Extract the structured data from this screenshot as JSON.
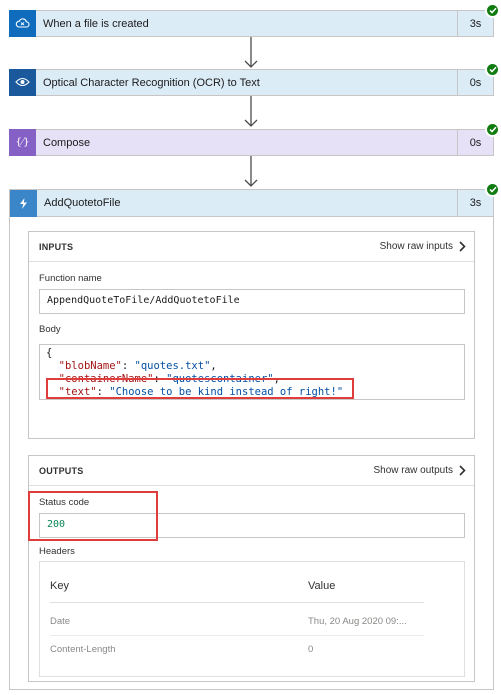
{
  "steps": [
    {
      "title": "When a file is created",
      "duration": "3s",
      "icon": "cloud-icon",
      "color": "#0f6cbd",
      "bg": "#dcecf7"
    },
    {
      "title": "Optical Character Recognition (OCR) to Text",
      "duration": "0s",
      "icon": "eye-icon",
      "color": "#1a5a9c",
      "bg": "#dcecf7"
    },
    {
      "title": "Compose",
      "duration": "0s",
      "icon": "braces-icon",
      "color": "#8661c5",
      "bg": "#e7e1f7"
    }
  ],
  "action": {
    "title": "AddQuotetoFile",
    "duration": "3s",
    "icon": "function-icon",
    "color": "#3b85c9"
  },
  "inputs": {
    "label": "INPUTS",
    "raw_link": "Show raw inputs",
    "function_name_label": "Function name",
    "function_name_value": "AppendQuoteToFile/AddQuotetoFile",
    "body_label": "Body",
    "body_lines": {
      "open": "{",
      "blobName_key": "\"blobName\"",
      "blobName_value": "\"quotes.txt\"",
      "containerName_key": "\"containerName\"",
      "containerName_value": "\"quotescontainer\"",
      "text_key": "\"text\"",
      "text_value": "\"Choose to be kind instead of right!\"",
      "close": "}"
    }
  },
  "outputs": {
    "label": "OUTPUTS",
    "raw_link": "Show raw outputs",
    "status_label": "Status code",
    "status_value": "200",
    "headers_label": "Headers",
    "table": {
      "col_key": "Key",
      "col_value": "Value",
      "rows": [
        {
          "key": "Date",
          "value": "Thu, 20 Aug 2020 09:..."
        },
        {
          "key": "Content-Length",
          "value": "0"
        }
      ]
    }
  },
  "colors": {
    "success": "#107c10",
    "highlight": "#e13c3c",
    "json_key": "#a31515",
    "json_string": "#0451a5"
  }
}
